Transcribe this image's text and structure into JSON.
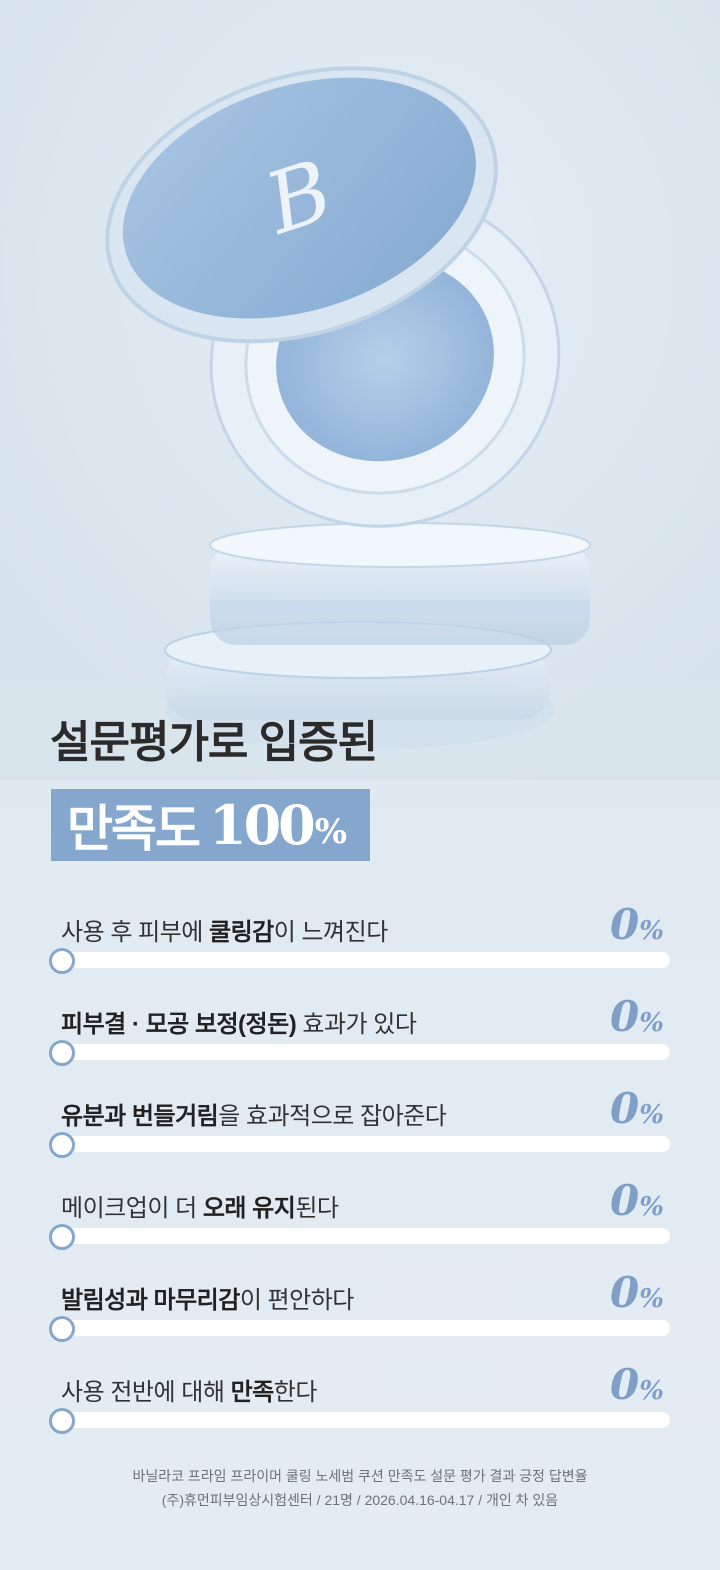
{
  "hero": {
    "brand_mark": "B",
    "image": "Vanilla Co cushion compact product photo"
  },
  "headline": "설문평가로 입증된",
  "badge": {
    "label": "만족도",
    "number": "100",
    "unit": "%"
  },
  "survey": [
    {
      "parts": [
        {
          "t": "사용 후 피부에 ",
          "b": false
        },
        {
          "t": "쿨링감",
          "b": true
        },
        {
          "t": "이 느껴진다",
          "b": false
        }
      ],
      "value": "0",
      "unit": "%",
      "fraction": 0
    },
    {
      "parts": [
        {
          "t": "피부결 · 모공 보정(정돈)",
          "b": true
        },
        {
          "t": " 효과가 있다",
          "b": false
        }
      ],
      "value": "0",
      "unit": "%",
      "fraction": 0
    },
    {
      "parts": [
        {
          "t": "유분과 번들거림",
          "b": true
        },
        {
          "t": "을 효과적으로 잡아준다",
          "b": false
        }
      ],
      "value": "0",
      "unit": "%",
      "fraction": 0
    },
    {
      "parts": [
        {
          "t": "메이크업이 더 ",
          "b": false
        },
        {
          "t": "오래 유지",
          "b": true
        },
        {
          "t": "된다",
          "b": false
        }
      ],
      "value": "0",
      "unit": "%",
      "fraction": 0
    },
    {
      "parts": [
        {
          "t": "발림성과 마무리감",
          "b": true
        },
        {
          "t": "이 편안하다",
          "b": false
        }
      ],
      "value": "0",
      "unit": "%",
      "fraction": 0
    },
    {
      "parts": [
        {
          "t": "사용 전반에 대해 ",
          "b": false
        },
        {
          "t": "만족",
          "b": true
        },
        {
          "t": "한다",
          "b": false
        }
      ],
      "value": "0",
      "unit": "%",
      "fraction": 0
    }
  ],
  "footnote": {
    "line1": "바닐라코 프라임 프라이머 쿨링 노세범 쿠션 만족도 설문 평가 결과 긍정 답변율",
    "line2": "(주)휴먼피부임상시험센터 / 21명 / 2026.04.16-04.17 / 개인 차 있음"
  },
  "colors": {
    "accent": "#86a7cd",
    "value": "#7f9fc9",
    "headline": "#2b2b2b"
  }
}
